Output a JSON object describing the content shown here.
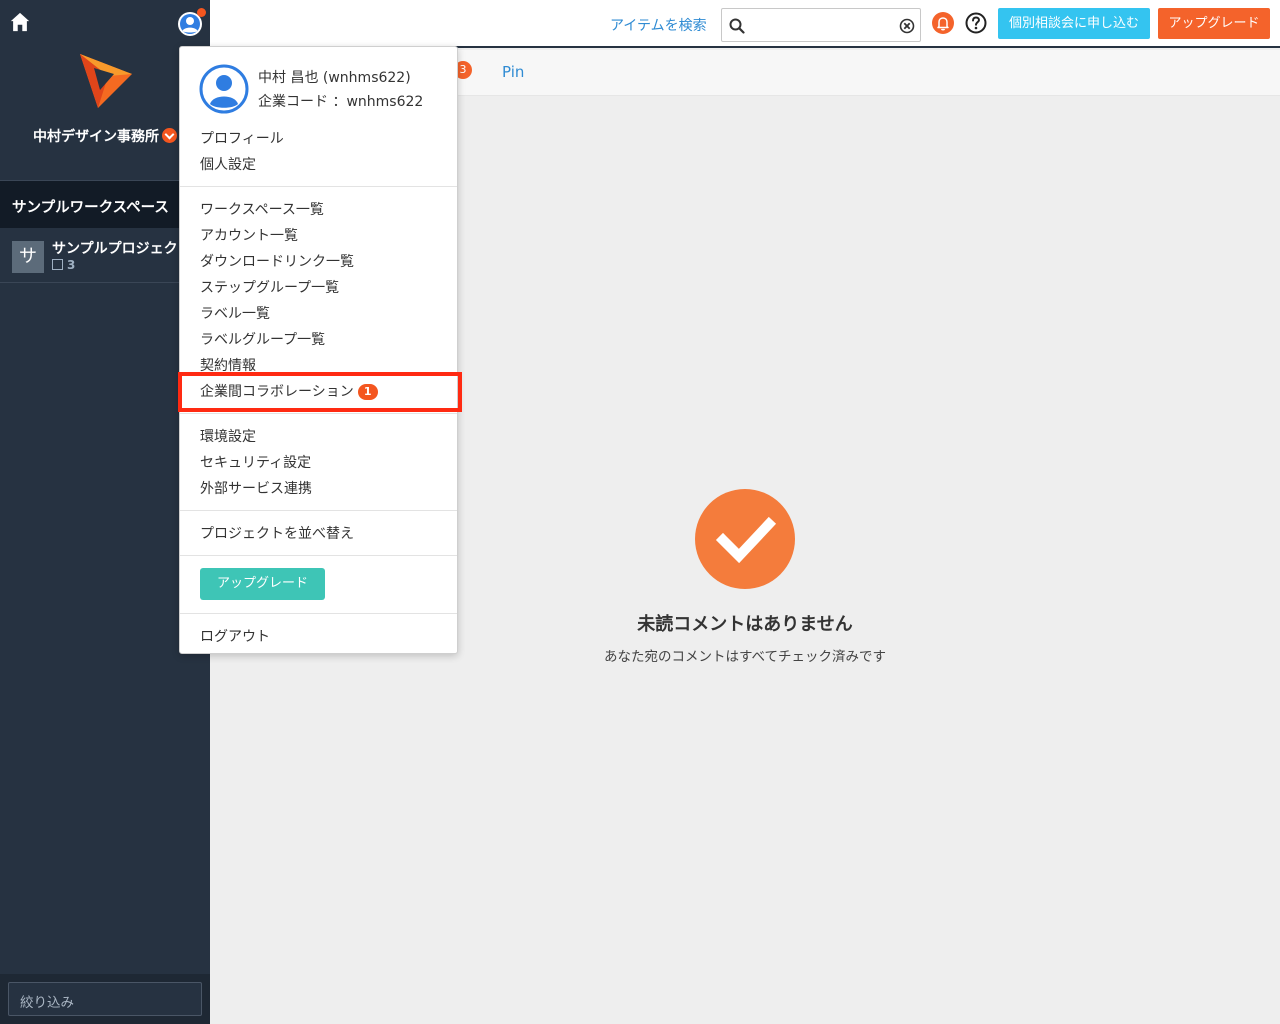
{
  "sidebar": {
    "company_name": "中村デザイン事務所",
    "workspace_title": "サンプルワークスペース",
    "project": {
      "avatar_letter": "サ",
      "name": "サンプルプロジェクト",
      "count": "3"
    },
    "filter_placeholder": "絞り込み"
  },
  "topbar": {
    "search_link": "アイテムを検索",
    "search_value": "",
    "consult_button": "個別相談会に申し込む",
    "upgrade_button": "アップグレード"
  },
  "tabs": {
    "badge_count": "3",
    "pin_label": "Pin"
  },
  "empty_state": {
    "title": "未読コメントはありません",
    "subtitle": "あなた宛のコメントはすべてチェック済みです"
  },
  "user_menu": {
    "user_name": "中村 昌也 (wnhms622)",
    "company_code": "企業コード ：wnhms622",
    "section1": [
      "プロフィール",
      "個人設定"
    ],
    "section2": [
      "ワークスペース一覧",
      "アカウント一覧",
      "ダウンロードリンク一覧",
      "ステップグループ一覧",
      "ラベル一覧",
      "ラベルグループ一覧",
      "契約情報"
    ],
    "collab_label": "企業間コラボレーション",
    "collab_badge": "1",
    "section3": [
      "環境設定",
      "セキュリティ設定",
      "外部サービス連携"
    ],
    "reorder_label": "プロジェクトを並べ替え",
    "upgrade_label": "アップグレード",
    "logout_label": "ログアウト"
  },
  "colors": {
    "sidebar_bg": "#263241",
    "accent_orange": "#f4632b",
    "consult_blue": "#34c4f0",
    "teal": "#3ec5b6",
    "highlight_red": "#ff2a12"
  }
}
